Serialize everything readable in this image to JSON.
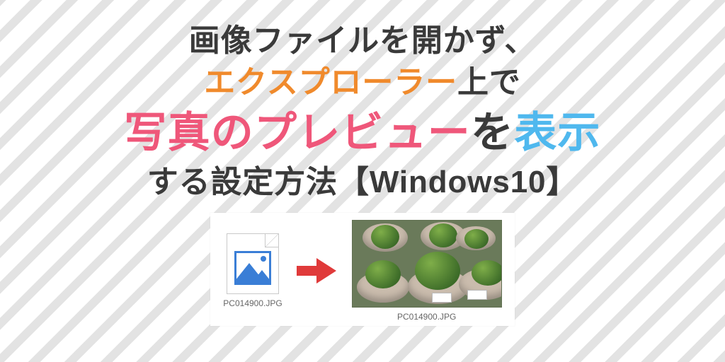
{
  "title": {
    "line1": "画像ファイルを開かず、",
    "line2_orange": "エクスプローラー",
    "line2_rest": "上で",
    "line3_red": "写真のプレビュー",
    "line3_mid": "を",
    "line3_blue": "表示",
    "line4": "する設定方法【Windows10】"
  },
  "illustration": {
    "left_caption": "PC014900.JPG",
    "right_caption": "PC014900.JPG"
  }
}
